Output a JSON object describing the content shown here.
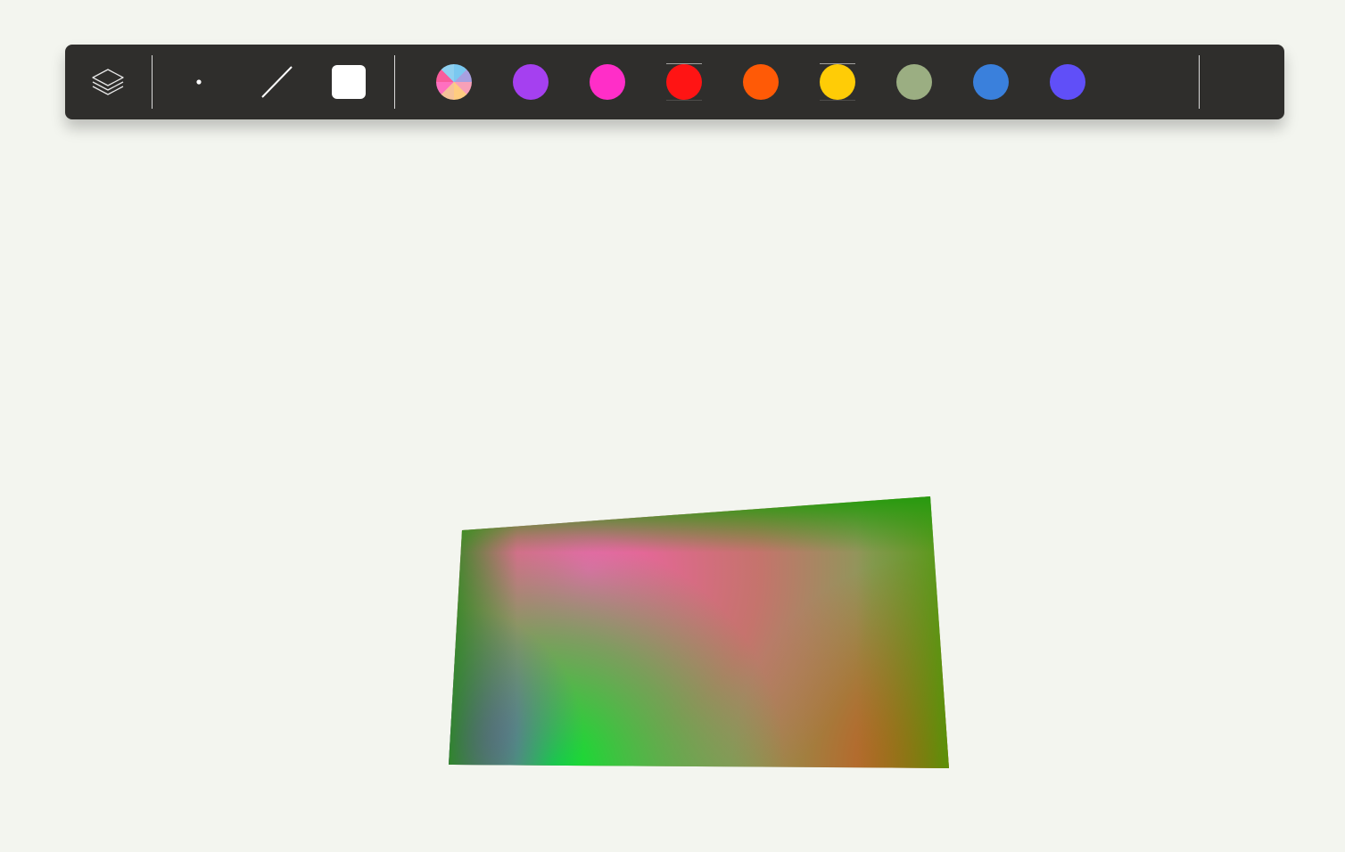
{
  "toolbar": {
    "tools": [
      {
        "name": "layers",
        "icon": "layers-icon"
      },
      {
        "name": "dot-brush",
        "icon": "dot-icon"
      },
      {
        "name": "line-brush",
        "icon": "line-icon"
      },
      {
        "name": "square-brush",
        "icon": "square-icon"
      }
    ],
    "swatches": [
      {
        "name": "multicolor",
        "color": "multicolor"
      },
      {
        "name": "purple",
        "color": "#a540f0"
      },
      {
        "name": "magenta",
        "color": "#ff2ec8"
      },
      {
        "name": "red",
        "color": "#ff1414"
      },
      {
        "name": "orange",
        "color": "#ff5a06"
      },
      {
        "name": "yellow",
        "color": "#ffcc06"
      },
      {
        "name": "sage",
        "color": "#9bae82"
      },
      {
        "name": "blue",
        "color": "#3a80dc"
      },
      {
        "name": "indigo",
        "color": "#604ff8"
      }
    ],
    "background": "#2f2e2c"
  },
  "canvas": {
    "background": "#f3f5ef",
    "shape_colors": [
      "#1f9a0c",
      "#f060b0",
      "#ec5a6a",
      "#00e030",
      "#c05020",
      "#7a40c0"
    ]
  }
}
